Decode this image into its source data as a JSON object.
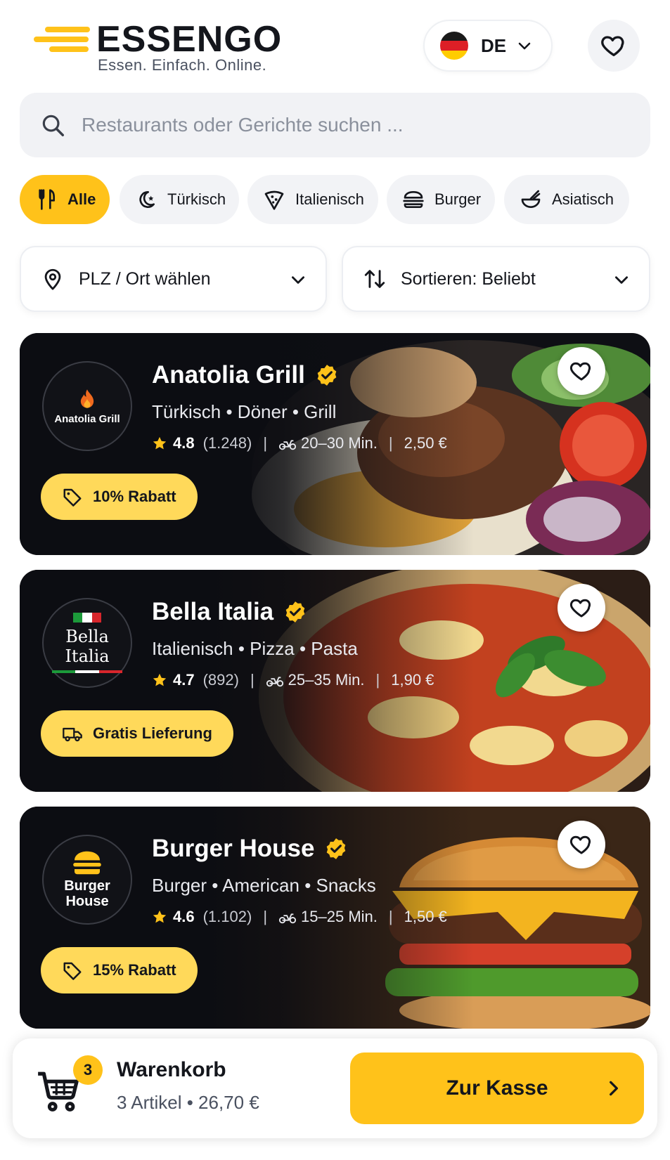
{
  "header": {
    "brand_name": "ESSENGO",
    "tagline": "Essen. Einfach. Online.",
    "language": "DE",
    "brand_color": "#ffc21a"
  },
  "search": {
    "placeholder": "Restaurants oder Gerichte suchen ..."
  },
  "categories": [
    {
      "label": "Alle",
      "icon": "cutlery-icon",
      "active": true
    },
    {
      "label": "Türkisch",
      "icon": "crescent-star-icon",
      "active": false
    },
    {
      "label": "Italienisch",
      "icon": "pizza-slice-icon",
      "active": false
    },
    {
      "label": "Burger",
      "icon": "burger-icon",
      "active": false
    },
    {
      "label": "Asiatisch",
      "icon": "bowl-chopsticks-icon",
      "active": false
    }
  ],
  "filters": {
    "location_label": "PLZ / Ort wählen",
    "sort_label": "Sortieren: Beliebt"
  },
  "restaurants": [
    {
      "name": "Anatolia Grill",
      "logo_text": "Anatolia Grill",
      "cuisine": "Türkisch • Döner • Grill",
      "rating": "4.8",
      "reviews": "(1.248)",
      "delivery_time": "20–30 Min.",
      "delivery_fee": "2,50 €",
      "badge": "10% Rabatt",
      "badge_icon": "tag-icon",
      "verified": true
    },
    {
      "name": "Bella Italia",
      "logo_text": "Bella Italia",
      "cuisine": "Italienisch • Pizza • Pasta",
      "rating": "4.7",
      "reviews": "(892)",
      "delivery_time": "25–35 Min.",
      "delivery_fee": "1,90 €",
      "badge": "Gratis Lieferung",
      "badge_icon": "delivery-truck-icon",
      "verified": true
    },
    {
      "name": "Burger House",
      "logo_text_1": "Burger",
      "logo_text_2": "House",
      "cuisine": "Burger • American • Snacks",
      "rating": "4.6",
      "reviews": "(1.102)",
      "delivery_time": "15–25 Min.",
      "delivery_fee": "1,50 €",
      "badge": "15% Rabatt",
      "badge_icon": "tag-icon",
      "verified": true
    }
  ],
  "cart": {
    "count": "3",
    "title": "Warenkorb",
    "summary": "3 Artikel • 26,70 €",
    "checkout_label": "Zur Kasse"
  }
}
